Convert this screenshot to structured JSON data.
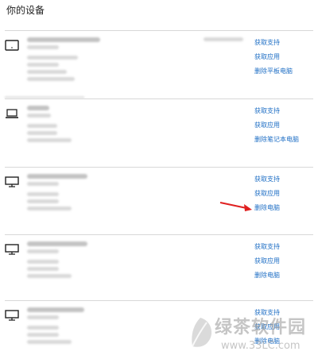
{
  "page_title": "你的设备",
  "devices": [
    {
      "type": "tablet",
      "icon": "tablet-icon",
      "actions": [
        "获取支持",
        "获取应用",
        "删除平板电脑"
      ]
    },
    {
      "type": "laptop",
      "icon": "laptop-icon",
      "actions": [
        "获取支持",
        "获取应用",
        "删除笔记本电脑"
      ]
    },
    {
      "type": "desktop",
      "icon": "monitor-icon",
      "actions": [
        "获取支持",
        "获取应用",
        "删除电脑"
      ]
    },
    {
      "type": "desktop",
      "icon": "monitor-icon",
      "actions": [
        "获取支持",
        "获取应用",
        "删除电脑"
      ]
    },
    {
      "type": "desktop",
      "icon": "monitor-icon",
      "actions": [
        "获取支持",
        "获取应用",
        "删除电脑"
      ]
    }
  ],
  "watermark": {
    "text": "绿茶软件园",
    "url": "www.33LC.com"
  },
  "colors": {
    "link": "#1f6fc5",
    "arrow": "#e02020",
    "divider": "#d8d8d8"
  }
}
